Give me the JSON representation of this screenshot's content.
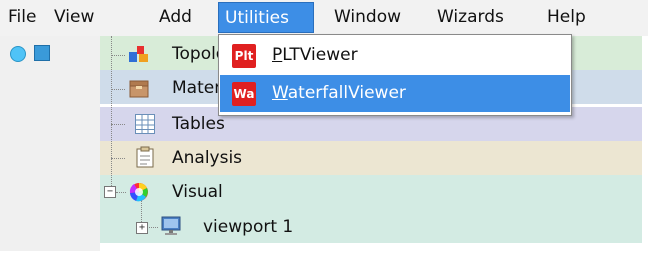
{
  "menubar": {
    "items": [
      "File",
      "View",
      "Add",
      "Utilities",
      "Window",
      "Wizards",
      "Help"
    ],
    "active_index": 3
  },
  "dropdown": {
    "items": [
      {
        "badge": "Plt",
        "label": "PLTViewer",
        "highlighted": false
      },
      {
        "badge": "Wa",
        "label": "WaterfallViewer",
        "highlighted": true
      }
    ]
  },
  "tree": {
    "nodes": [
      {
        "label": "Topology",
        "icon": "blocks-icon"
      },
      {
        "label": "Materials",
        "icon": "box-icon"
      },
      {
        "label": "Tables",
        "icon": "table-icon"
      },
      {
        "label": "Analysis",
        "icon": "clipboard-icon"
      },
      {
        "label": "Visual",
        "icon": "color-wheel-icon",
        "expanded": true
      },
      {
        "label": "viewport 1",
        "icon": "monitor-icon",
        "expandable": true
      }
    ]
  },
  "colors": {
    "accent": "#3d8ee6",
    "row_green": "#d8ecd8",
    "row_blue": "#cfdcea",
    "row_lavender": "#d6d6ec",
    "row_beige": "#ece6d2",
    "row_teal": "#d3ebe3",
    "badge_red": "#e02020"
  }
}
